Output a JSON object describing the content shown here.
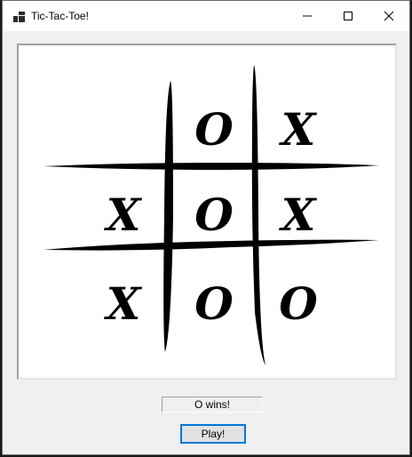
{
  "window": {
    "title": "Tic-Tac-Toe!"
  },
  "board": {
    "cells": [
      [
        "",
        "O",
        "X"
      ],
      [
        "X",
        "O",
        "X"
      ],
      [
        "X",
        "O",
        "O"
      ]
    ]
  },
  "status": {
    "text": "O wins!"
  },
  "controls": {
    "play_label": "Play!"
  },
  "icons": {
    "app": "app-grid-icon",
    "minimize": "minimize-icon",
    "maximize": "maximize-icon",
    "close": "close-icon"
  },
  "colors": {
    "accent": "#0078d7",
    "ink": "#000000"
  }
}
